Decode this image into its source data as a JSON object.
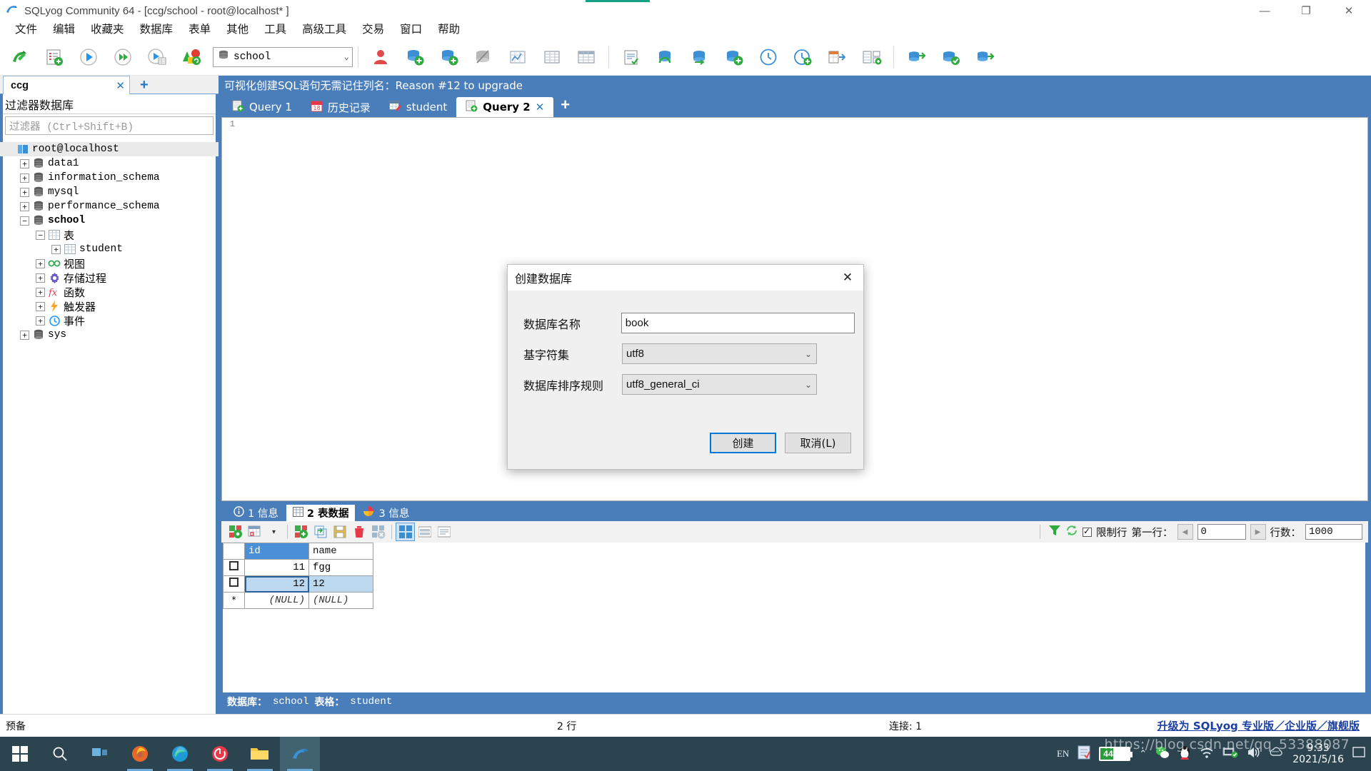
{
  "window": {
    "title": "SQLyog Community 64 - [ccg/school - root@localhost* ]",
    "minimize": "—",
    "maximize": "❐",
    "close": "✕"
  },
  "menubar": {
    "items": [
      {
        "label": "文件"
      },
      {
        "label": "编辑"
      },
      {
        "label": "收藏夹"
      },
      {
        "label": "数据库"
      },
      {
        "label": "表单"
      },
      {
        "label": "其他"
      },
      {
        "label": "工具"
      },
      {
        "label": "高级工具"
      },
      {
        "label": "交易"
      },
      {
        "label": "窗口"
      },
      {
        "label": "帮助"
      }
    ]
  },
  "toolbar": {
    "db_combo_value": "school",
    "db_combo_chevron": "⌄"
  },
  "sidebar": {
    "connection_tab": {
      "label": "ccg",
      "close": "✕"
    },
    "add_tab": "+",
    "filter_title": "过滤器数据库",
    "filter_placeholder": "过滤器 (Ctrl+Shift+B)",
    "tree": [
      {
        "label": "root@localhost",
        "indent": 0,
        "expander": "",
        "icon": "server-icon",
        "bold": false,
        "cjk": false,
        "selected": true
      },
      {
        "label": "data1",
        "indent": 1,
        "expander": "+",
        "icon": "database-icon",
        "bold": false,
        "cjk": false,
        "selected": false
      },
      {
        "label": "information_schema",
        "indent": 1,
        "expander": "+",
        "icon": "database-icon",
        "bold": false,
        "cjk": false,
        "selected": false
      },
      {
        "label": "mysql",
        "indent": 1,
        "expander": "+",
        "icon": "database-icon",
        "bold": false,
        "cjk": false,
        "selected": false
      },
      {
        "label": "performance_schema",
        "indent": 1,
        "expander": "+",
        "icon": "database-icon",
        "bold": false,
        "cjk": false,
        "selected": false
      },
      {
        "label": "school",
        "indent": 1,
        "expander": "−",
        "icon": "database-icon",
        "bold": true,
        "cjk": false,
        "selected": false
      },
      {
        "label": "表",
        "indent": 2,
        "expander": "−",
        "icon": "table-folder-icon",
        "bold": false,
        "cjk": true,
        "selected": false
      },
      {
        "label": "student",
        "indent": 3,
        "expander": "+",
        "icon": "table-icon",
        "bold": false,
        "cjk": false,
        "selected": false
      },
      {
        "label": "视图",
        "indent": 2,
        "expander": "+",
        "icon": "view-icon",
        "bold": false,
        "cjk": true,
        "selected": false
      },
      {
        "label": "存储过程",
        "indent": 2,
        "expander": "+",
        "icon": "procedure-icon",
        "bold": false,
        "cjk": true,
        "selected": false
      },
      {
        "label": "函数",
        "indent": 2,
        "expander": "+",
        "icon": "function-icon",
        "bold": false,
        "cjk": true,
        "selected": false
      },
      {
        "label": "触发器",
        "indent": 2,
        "expander": "+",
        "icon": "trigger-icon",
        "bold": false,
        "cjk": true,
        "selected": false
      },
      {
        "label": "事件",
        "indent": 2,
        "expander": "+",
        "icon": "event-icon",
        "bold": false,
        "cjk": true,
        "selected": false
      },
      {
        "label": "sys",
        "indent": 1,
        "expander": "+",
        "icon": "database-icon",
        "bold": false,
        "cjk": false,
        "selected": false
      }
    ]
  },
  "main": {
    "promo_text": "可视化创建SQL语句无需记住列名：Reason #12 to upgrade",
    "query_tabs": [
      {
        "label": "Query 1",
        "icon": "query-icon",
        "active": false,
        "close": ""
      },
      {
        "label": "历史记录",
        "icon": "history-icon",
        "active": false,
        "close": ""
      },
      {
        "label": "student",
        "icon": "table-edit-icon",
        "active": false,
        "close": ""
      },
      {
        "label": "Query 2",
        "icon": "query-icon",
        "active": true,
        "close": "✕"
      }
    ],
    "add_query_tab": "+",
    "editor_line_number": "1",
    "editor_content": ""
  },
  "results": {
    "tabs": [
      {
        "label": "1 信息",
        "icon": "info-icon",
        "active": false
      },
      {
        "label": "2 表数据",
        "icon": "grid-icon",
        "active": true
      },
      {
        "label": "3 信息",
        "icon": "chart-icon",
        "active": false
      }
    ],
    "limit": {
      "filter_icon": "funnel-icon",
      "refresh_icon": "refresh-icon",
      "checkbox_label": "限制行",
      "checkbox_checked": true,
      "first_row_label": "第一行：",
      "first_row_value": "0",
      "prev_arrow": "◀",
      "next_arrow": "▶",
      "row_count_label": "行数：",
      "row_count_value": "1000"
    },
    "grid": {
      "columns": [
        "id",
        "name"
      ],
      "rows": [
        {
          "id": "11",
          "name": "fgg",
          "selected": false
        },
        {
          "id": "12",
          "name": "12",
          "selected": true
        },
        {
          "id": "(NULL)",
          "name": "(NULL)",
          "selected": false,
          "is_new": true
        }
      ],
      "new_row_marker": "*"
    },
    "status": {
      "db_label": "数据库：",
      "db_value": "school",
      "table_label": "表格：",
      "table_value": "student"
    }
  },
  "dialog": {
    "title": "创建数据库",
    "close": "✕",
    "fields": [
      {
        "label": "数据库名称",
        "value": "book",
        "type": "text"
      },
      {
        "label": "基字符集",
        "value": "utf8",
        "type": "select"
      },
      {
        "label": "数据库排序规则",
        "value": "utf8_general_ci",
        "type": "select"
      }
    ],
    "chevron": "⌄",
    "create_button": "创建",
    "cancel_button": "取消(L)"
  },
  "statusbar": {
    "ready": "预备",
    "rows": "2 行",
    "connections": "连接: 1",
    "upgrade_link": "升级为 SQLyog 专业版／企业版／旗舰版"
  },
  "taskbar": {
    "items": [
      {
        "name": "start-button",
        "icon": "windows-icon"
      },
      {
        "name": "search-button",
        "icon": "search-icon"
      },
      {
        "name": "task-view-button",
        "icon": "task-view-icon"
      },
      {
        "name": "firefox-taskbar-item",
        "icon": "firefox-icon"
      },
      {
        "name": "edge-taskbar-item",
        "icon": "edge-icon"
      },
      {
        "name": "app-taskbar-item",
        "icon": "media-icon"
      },
      {
        "name": "explorer-taskbar-item",
        "icon": "folder-icon"
      },
      {
        "name": "sqlyog-taskbar-item",
        "icon": "sqlyog-icon"
      }
    ],
    "tray": {
      "input_language": "EN",
      "battery_percent": "44%",
      "chevron": "⌃",
      "clock_time": "9:33",
      "clock_date": "2021/5/16"
    },
    "watermark": "https://blog.csdn.net/qq_53388087"
  },
  "colors": {
    "accent_blue": "#4a7ebb",
    "header_blue": "#4a90d9",
    "focus_blue": "#0078d7",
    "selection_blue": "#bcd8ef",
    "taskbar": "#2b4450"
  }
}
